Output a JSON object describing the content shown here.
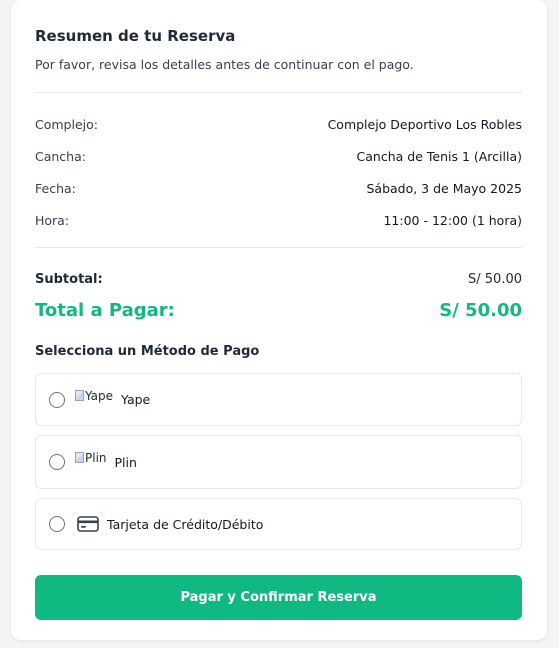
{
  "summary": {
    "title": "Resumen de tu Reserva",
    "subtitle": "Por favor, revisa los detalles antes de continuar con el pago."
  },
  "details": [
    {
      "label": "Complejo:",
      "value": "Complejo Deportivo Los Robles"
    },
    {
      "label": "Cancha:",
      "value": "Cancha de Tenis 1 (Arcilla)"
    },
    {
      "label": "Fecha:",
      "value": "Sábado, 3 de Mayo 2025"
    },
    {
      "label": "Hora:",
      "value": "11:00 - 12:00 (1 hora)"
    }
  ],
  "totals": {
    "subtotal_label": "Subtotal:",
    "subtotal_value": "S/ 50.00",
    "total_label": "Total a Pagar:",
    "total_value": "S/ 50.00"
  },
  "payment": {
    "heading": "Selecciona un Método de Pago",
    "options": [
      {
        "alt": "Yape",
        "label": "Yape",
        "icon": "broken-image"
      },
      {
        "alt": "Plin",
        "label": "Plin",
        "icon": "broken-image"
      },
      {
        "alt": "",
        "label": "Tarjeta de Crédito/Débito",
        "icon": "credit-card-icon"
      }
    ]
  },
  "actions": {
    "pay_label": "Pagar y Confirmar Reserva"
  },
  "colors": {
    "accent": "#10b981"
  }
}
